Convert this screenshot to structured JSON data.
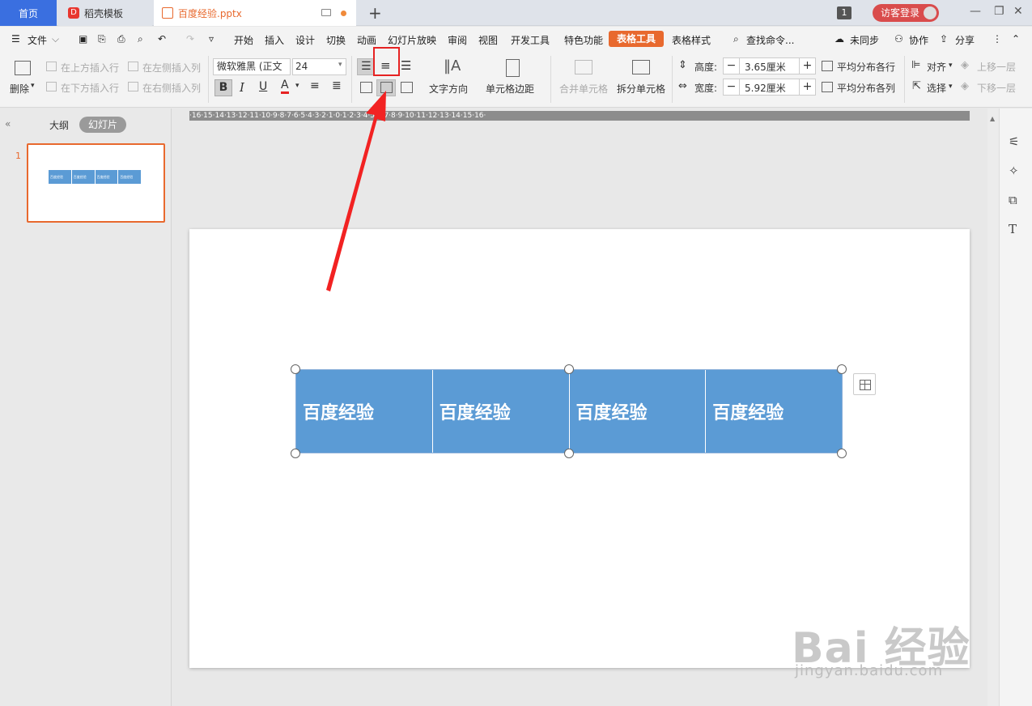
{
  "titlebar": {
    "tabs": [
      {
        "label": "首页"
      },
      {
        "label": "稻壳模板"
      },
      {
        "label": "百度经验.pptx"
      }
    ],
    "new_tab": "+",
    "window_count": "1",
    "login": "访客登录",
    "min": "—",
    "restore": "❐",
    "close": "✕"
  },
  "menubar": {
    "file": "文件",
    "items": [
      "开始",
      "插入",
      "设计",
      "切换",
      "动画",
      "幻灯片放映",
      "审阅",
      "视图",
      "开发工具",
      "特色功能"
    ],
    "active": "表格工具",
    "table_style": "表格样式",
    "search": "查找命令...",
    "sync": "未同步",
    "collab": "协作",
    "share": "分享"
  },
  "ribbon": {
    "delete": "删除",
    "insert_above": "在上方插入行",
    "insert_below": "在下方插入行",
    "insert_left": "在左侧插入列",
    "insert_right": "在右侧插入列",
    "font_name": "微软雅黑 (正文",
    "font_size": "24",
    "bold": "B",
    "italic": "I",
    "underline": "U",
    "font_color": "A",
    "text_direction": "文字方向",
    "cell_margin": "单元格边距",
    "merge": "合并单元格",
    "split": "拆分单元格",
    "height_label": "高度:",
    "height_value": "3.65厘米",
    "width_label": "宽度:",
    "width_value": "5.92厘米",
    "dist_rows": "平均分布各行",
    "dist_cols": "平均分布各列",
    "align": "对齐",
    "select": "选择",
    "bring_forward": "上移一层",
    "send_backward": "下移一层"
  },
  "leftpanel": {
    "outline": "大纲",
    "slides": "幻灯片",
    "slide_number": "1",
    "thumb_cell": "百度经验"
  },
  "ruler": "·16·15·14·13·12·11·10·9·8·7·6·5·4·3·2·1·0·1·2·3·4·5·6·7·8·9·10·11·12·13·14·15·16·",
  "slide": {
    "cells": [
      "百度经验",
      "百度经验",
      "百度经验",
      "百度经验"
    ]
  },
  "watermark": {
    "main": "Bai 经验",
    "url": "jingyan.baidu.com"
  },
  "colors": {
    "accent": "#e8692e",
    "home_tab": "#3a6fe0",
    "table_fill": "#5b9bd5",
    "annotation": "#e62222"
  }
}
